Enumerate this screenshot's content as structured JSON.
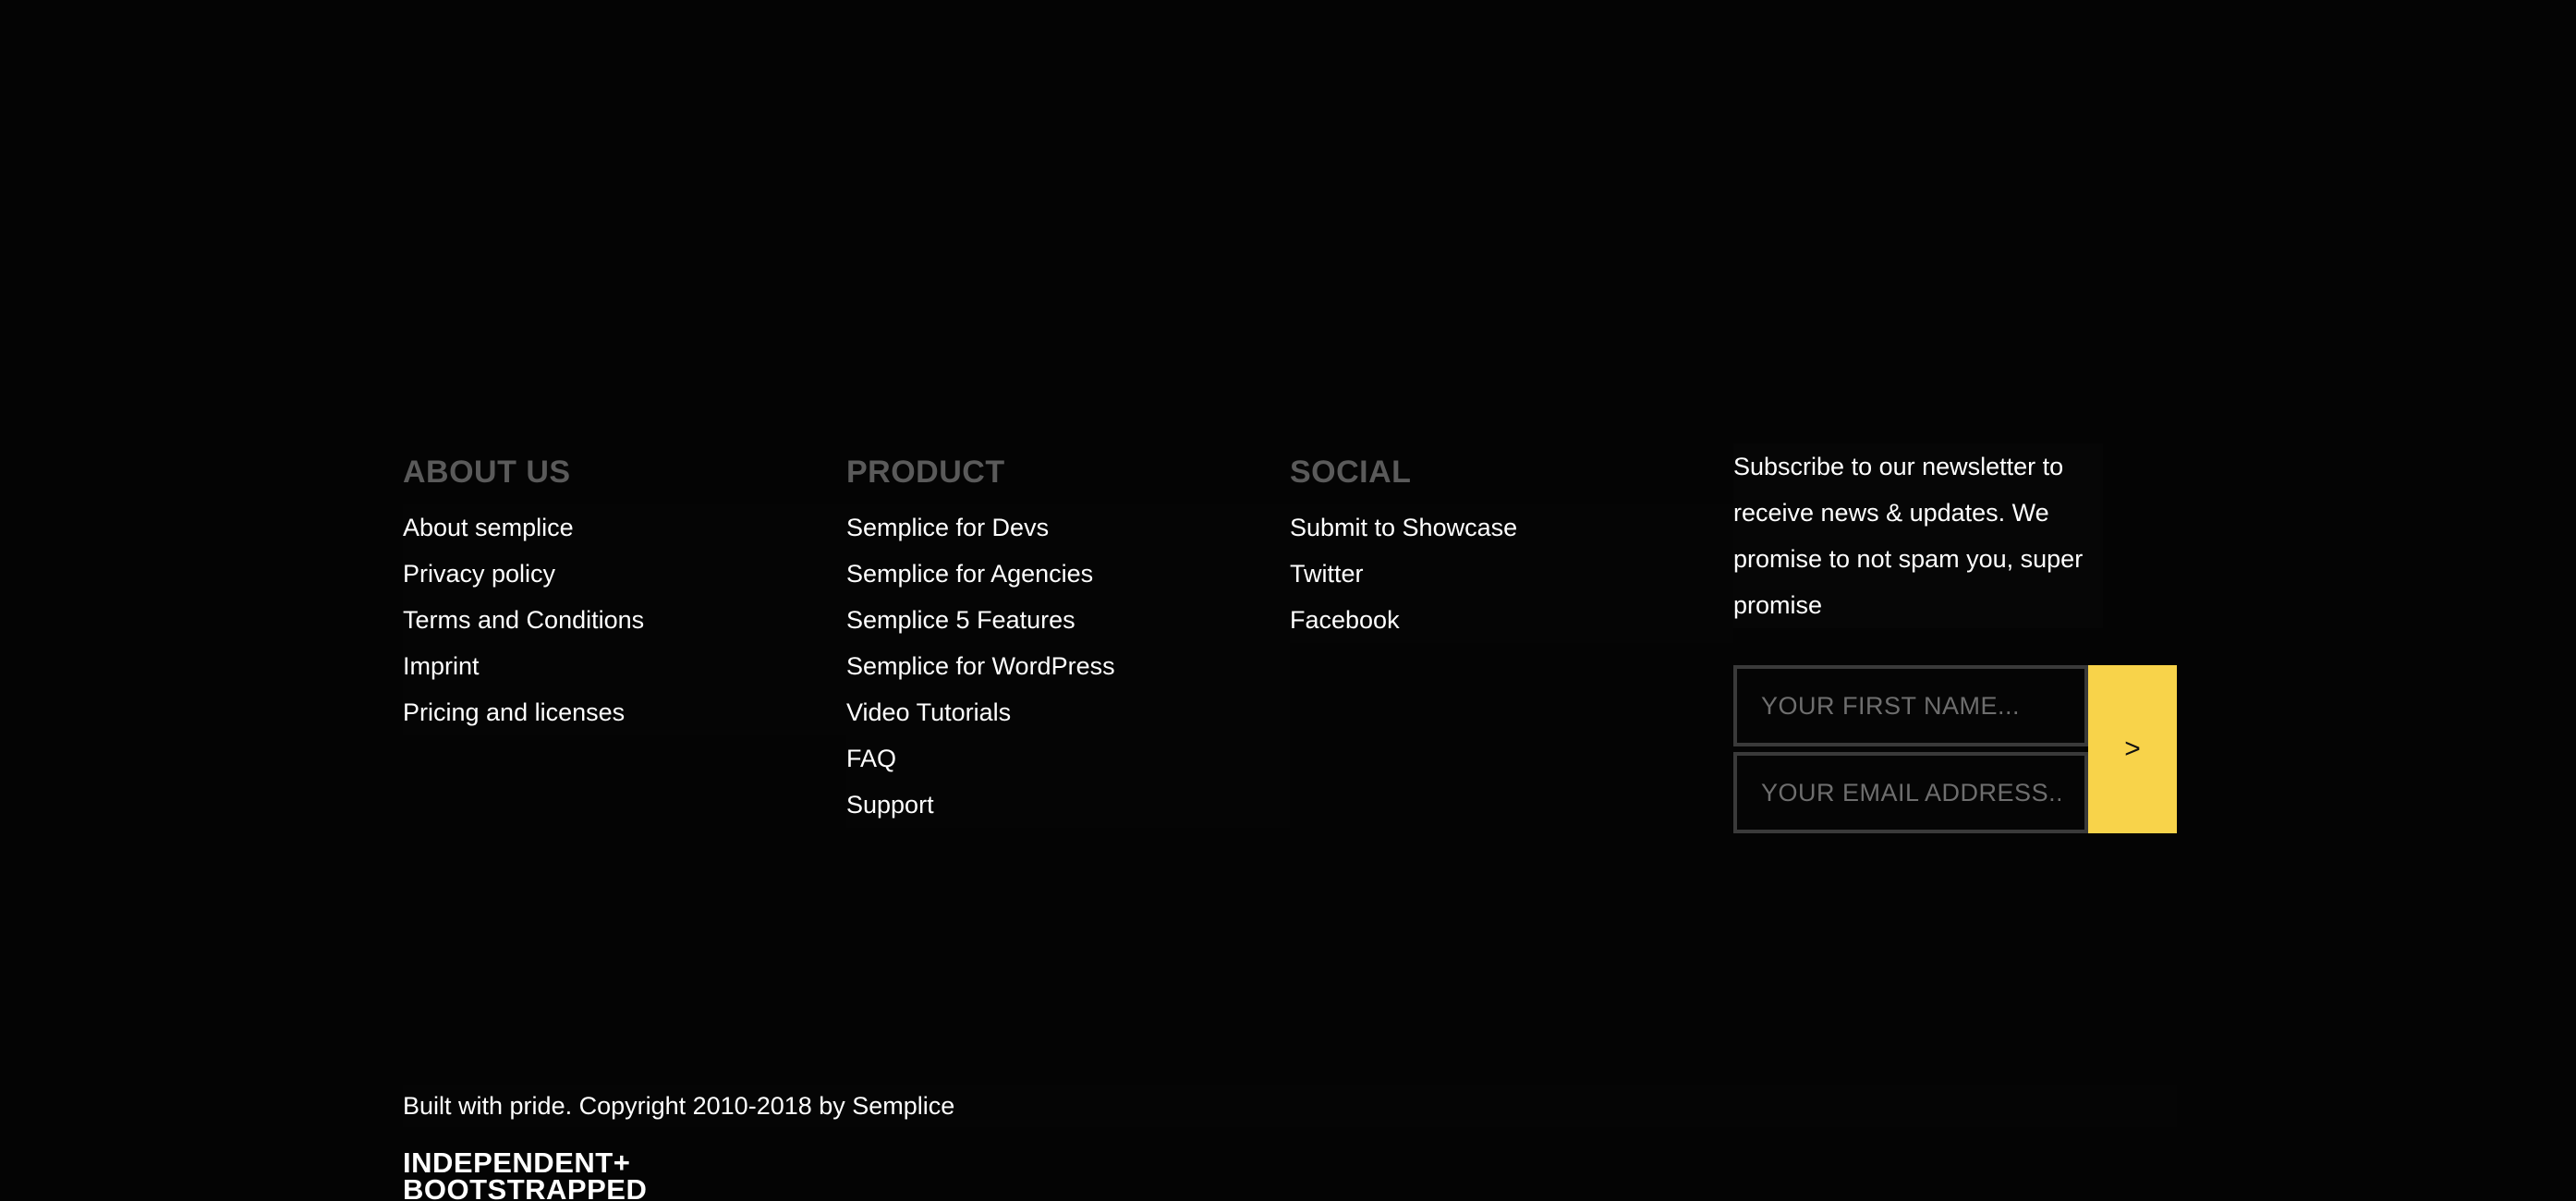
{
  "about": {
    "heading": "ABOUT US",
    "links": [
      "About semplice",
      "Privacy policy",
      "Terms and Conditions",
      "Imprint",
      "Pricing and licenses"
    ]
  },
  "product": {
    "heading": "PRODUCT",
    "links": [
      "Semplice for Devs",
      "Semplice for Agencies",
      "Semplice 5 Features",
      "Semplice for WordPress",
      "Video Tutorials",
      "FAQ",
      "Support"
    ]
  },
  "social": {
    "heading": "SOCIAL",
    "links": [
      "Submit to Showcase",
      "Twitter",
      "Facebook"
    ]
  },
  "newsletter": {
    "text": "Subscribe to our newsletter to receive news & updates. We promise to not spam you, super promise",
    "first_name_placeholder": "YOUR FIRST NAME...",
    "email_placeholder": "YOUR EMAIL ADDRESS...",
    "submit_label": ">"
  },
  "copyright": "Built with pride. Copyright 2010-2018 by Semplice",
  "badge": {
    "line1": "INDEPENDENT+",
    "line2": "BOOTSTRAPPED"
  },
  "colors": {
    "background": "#040404",
    "heading": "#5a5a5a",
    "accent": "#f8d34a",
    "text": "#ffffff"
  }
}
